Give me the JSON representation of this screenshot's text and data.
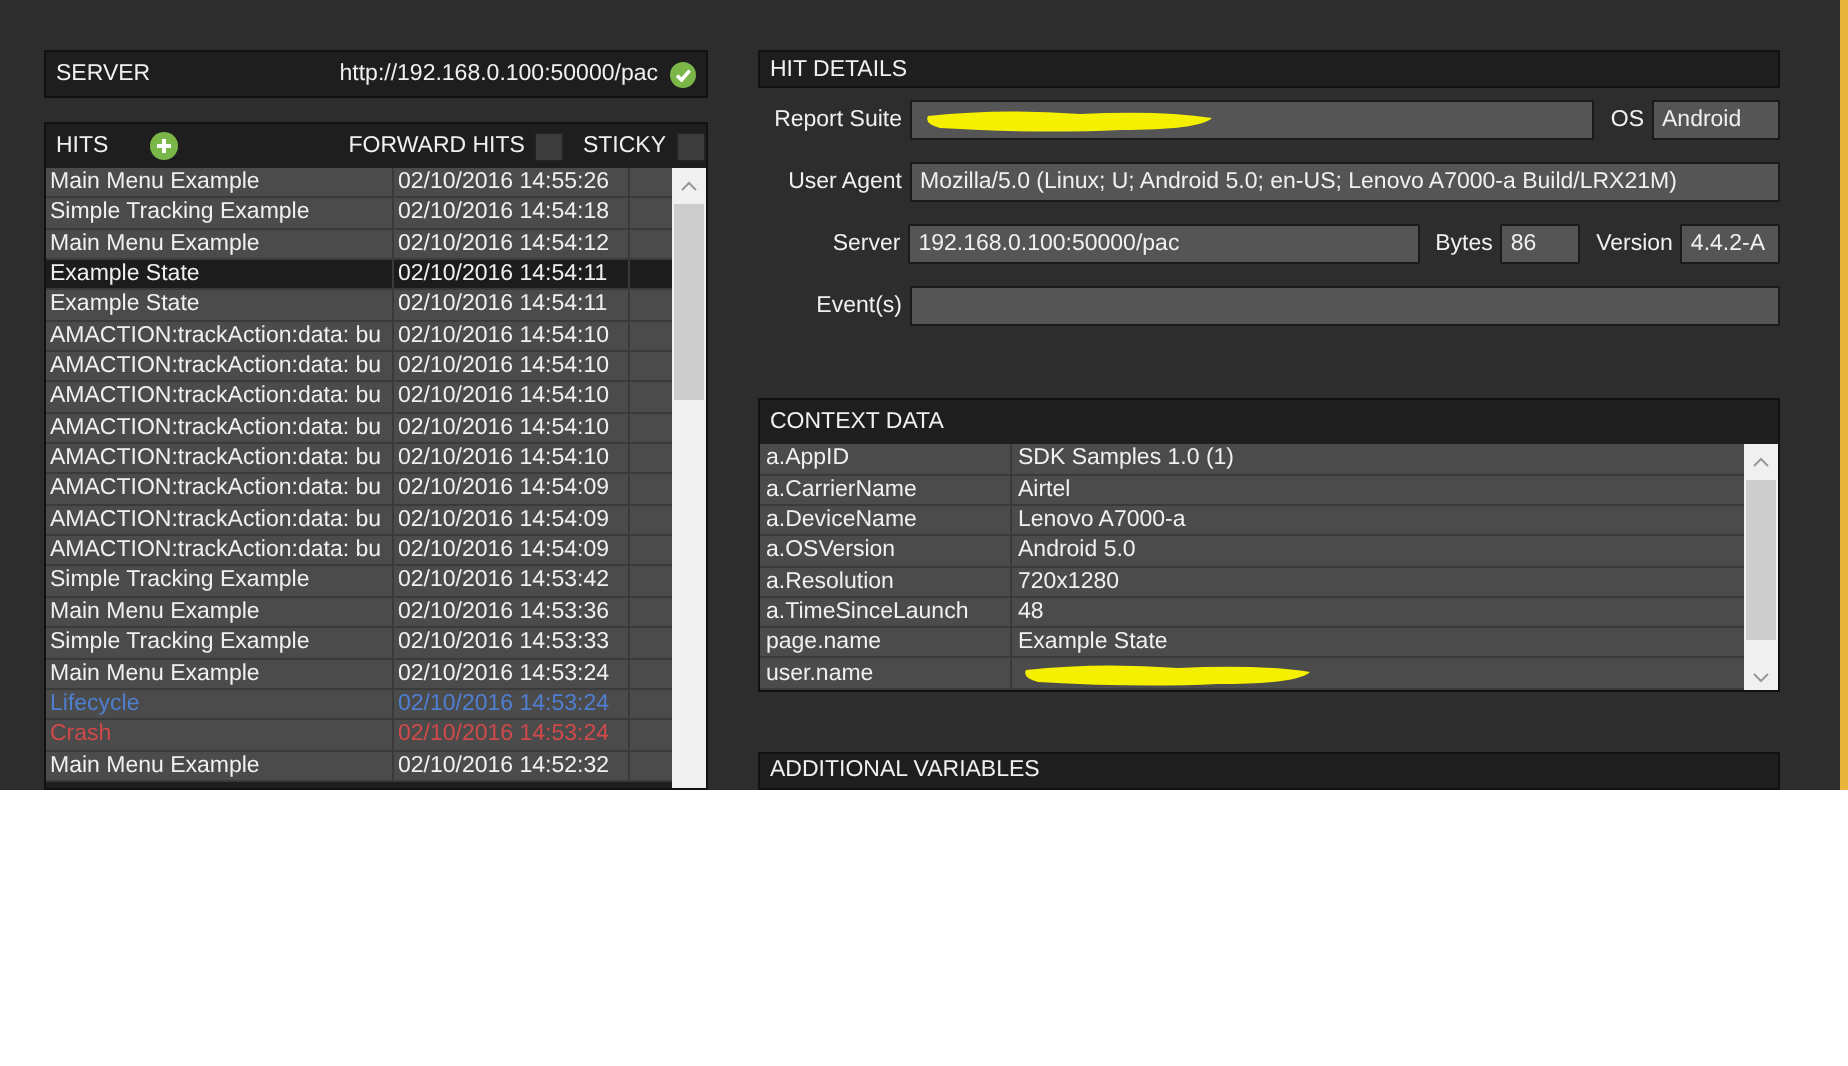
{
  "server": {
    "label": "SERVER",
    "url": "http://192.168.0.100:50000/pac",
    "connected": true
  },
  "hits": {
    "title": "HITS",
    "forward_hits": {
      "label": "FORWARD HITS",
      "checked": false
    },
    "sticky": {
      "label": "STICKY",
      "checked": false
    },
    "rows": [
      {
        "name": "Main Menu Example",
        "time": "02/10/2016 14:55:26",
        "selected": false
      },
      {
        "name": "Simple Tracking Example",
        "time": "02/10/2016 14:54:18",
        "selected": false
      },
      {
        "name": "Main Menu Example",
        "time": "02/10/2016 14:54:12",
        "selected": false
      },
      {
        "name": "Example State",
        "time": "02/10/2016 14:54:11",
        "selected": true
      },
      {
        "name": "Example State",
        "time": "02/10/2016 14:54:11",
        "selected": false
      },
      {
        "name": "AMACTION:trackAction:data: bu",
        "time": "02/10/2016 14:54:10",
        "selected": false
      },
      {
        "name": "AMACTION:trackAction:data: bu",
        "time": "02/10/2016 14:54:10",
        "selected": false
      },
      {
        "name": "AMACTION:trackAction:data: bu",
        "time": "02/10/2016 14:54:10",
        "selected": false
      },
      {
        "name": "AMACTION:trackAction:data: bu",
        "time": "02/10/2016 14:54:10",
        "selected": false
      },
      {
        "name": "AMACTION:trackAction:data: bu",
        "time": "02/10/2016 14:54:10",
        "selected": false
      },
      {
        "name": "AMACTION:trackAction:data: bu",
        "time": "02/10/2016 14:54:09",
        "selected": false
      },
      {
        "name": "AMACTION:trackAction:data: bu",
        "time": "02/10/2016 14:54:09",
        "selected": false
      },
      {
        "name": "AMACTION:trackAction:data: bu",
        "time": "02/10/2016 14:54:09",
        "selected": false
      },
      {
        "name": "Simple Tracking Example",
        "time": "02/10/2016 14:53:42",
        "selected": false
      },
      {
        "name": "Main Menu Example",
        "time": "02/10/2016 14:53:36",
        "selected": false
      },
      {
        "name": "Simple Tracking Example",
        "time": "02/10/2016 14:53:33",
        "selected": false
      },
      {
        "name": "Main Menu Example",
        "time": "02/10/2016 14:53:24",
        "selected": false
      },
      {
        "name": "Lifecycle",
        "time": "02/10/2016 14:53:24",
        "selected": false,
        "color": "#4f7fd0"
      },
      {
        "name": "Crash",
        "time": "02/10/2016 14:53:24",
        "selected": false,
        "color": "#d04a4a"
      },
      {
        "name": "Main Menu Example",
        "time": "02/10/2016 14:52:32",
        "selected": false
      }
    ]
  },
  "hit_details": {
    "title": "HIT DETAILS",
    "report_suite": {
      "label": "Report Suite",
      "redacted": true
    },
    "os": {
      "label": "OS",
      "value": "Android"
    },
    "user_agent": {
      "label": "User Agent",
      "value": "Mozilla/5.0 (Linux; U; Android 5.0; en-US; Lenovo A7000-a Build/LRX21M)"
    },
    "server": {
      "label": "Server",
      "value": "192.168.0.100:50000/pac"
    },
    "bytes": {
      "label": "Bytes",
      "value": "86"
    },
    "version": {
      "label": "Version",
      "value": "4.4.2-A"
    },
    "events": {
      "label": "Event(s)"
    }
  },
  "context_data": {
    "title": "CONTEXT DATA",
    "rows": [
      {
        "key": "a.AppID",
        "value": "SDK Samples 1.0 (1)"
      },
      {
        "key": "a.CarrierName",
        "value": "Airtel"
      },
      {
        "key": "a.DeviceName",
        "value": "Lenovo A7000-a"
      },
      {
        "key": "a.OSVersion",
        "value": "Android 5.0"
      },
      {
        "key": "a.Resolution",
        "value": "720x1280"
      },
      {
        "key": "a.TimeSinceLaunch",
        "value": "48"
      },
      {
        "key": "page.name",
        "value": "Example State"
      },
      {
        "key": "user.name",
        "redacted": true
      }
    ]
  },
  "additional_variables": {
    "title": "ADDITIONAL VARIABLES"
  }
}
